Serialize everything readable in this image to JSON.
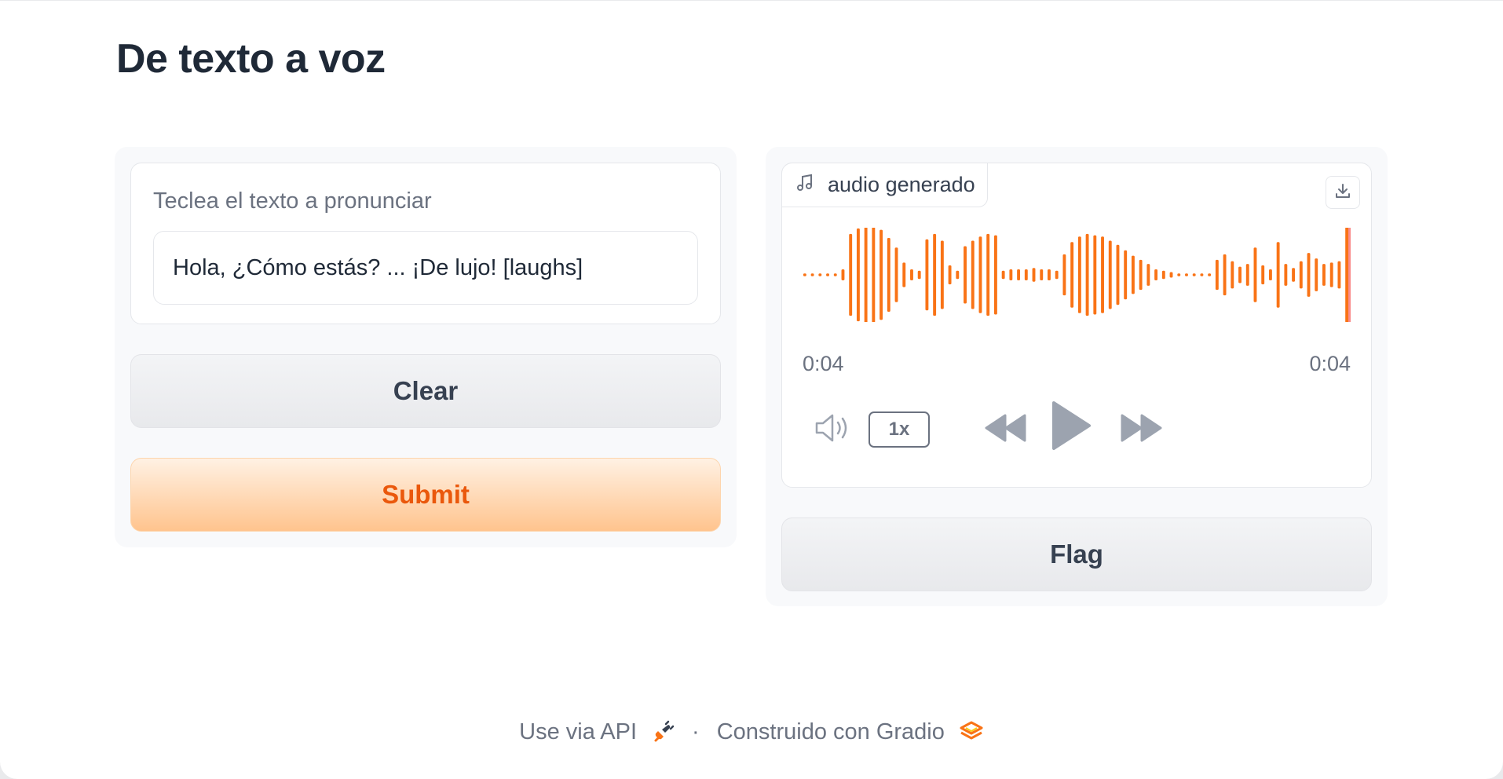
{
  "page": {
    "title": "De texto a voz"
  },
  "inputs": {
    "label": "Teclea el texto a pronunciar",
    "text_value": "Hola, ¿Cómo estás? ... ¡De lujo! [laughs]"
  },
  "buttons": {
    "clear": "Clear",
    "submit": "Submit",
    "flag": "Flag"
  },
  "audio": {
    "label": "audio generado",
    "current_time": "0:04",
    "total_time": "0:04",
    "playback_rate": "1x",
    "progress": 1.0,
    "waveform_color": "#f97316"
  },
  "footer": {
    "api_link": "Use via API",
    "separator": "·",
    "built_with": "Construido con Gradio"
  },
  "colors": {
    "accent": "#ea580c",
    "accent_light": "#ffc48e",
    "muted": "#6b7280"
  },
  "icons": {
    "audio_tag": "music-note-icon",
    "download": "download-icon",
    "volume": "volume-icon",
    "rewind": "rewind-icon",
    "play": "play-icon",
    "forward": "fast-forward-icon",
    "api": "plug-icon",
    "gradio": "gradio-logo-icon"
  }
}
